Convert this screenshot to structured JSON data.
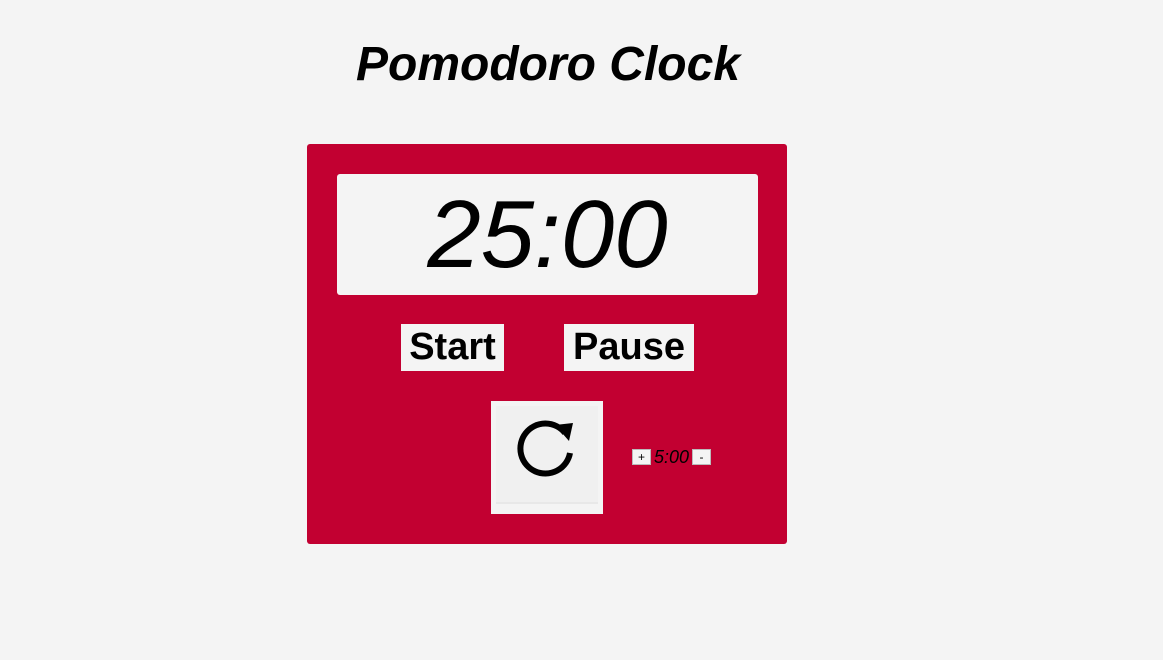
{
  "app": {
    "title": "Pomodoro Clock"
  },
  "timer": {
    "display": "25:00"
  },
  "controls": {
    "start_label": "Start",
    "pause_label": "Pause",
    "reset_icon": "refresh-icon"
  },
  "adjust": {
    "increment_label": "+",
    "value": "5:00",
    "decrement_label": "-"
  },
  "colors": {
    "background": "#f4f4f4",
    "card": "#c20031",
    "text": "#000000"
  }
}
